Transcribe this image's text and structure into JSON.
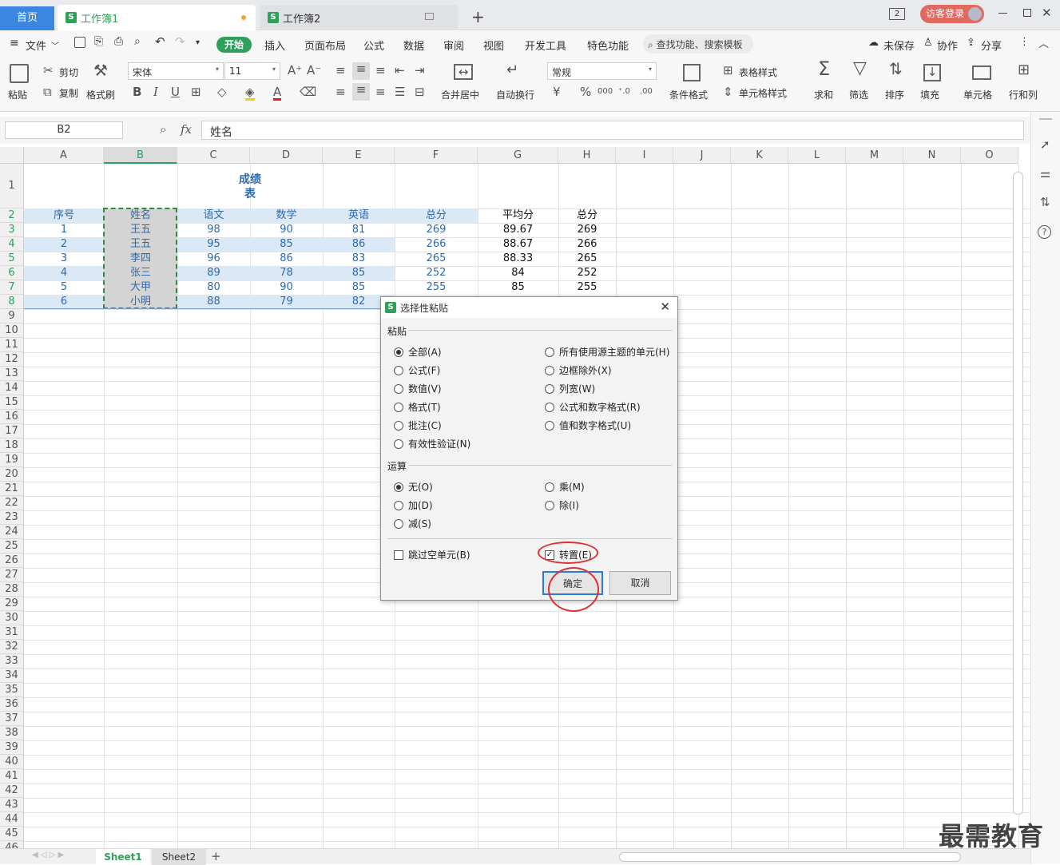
{
  "tabs": {
    "home": "首页",
    "book1": "工作簿1",
    "book2": "工作簿2",
    "plus": "+",
    "badge": "2",
    "login": "访客登录"
  },
  "menu": {
    "file": "文件",
    "items": [
      "开始",
      "插入",
      "页面布局",
      "公式",
      "数据",
      "审阅",
      "视图",
      "开发工具",
      "特色功能"
    ],
    "search": "查找功能、搜索模板",
    "unsaved": "未保存",
    "collab": "协作",
    "share": "分享"
  },
  "ribbon": {
    "paste": "粘贴",
    "cut": "剪切",
    "copy": "复制",
    "format_painter": "格式刷",
    "font": "宋体",
    "size": "11",
    "bold": "B",
    "italic": "I",
    "underline": "U",
    "merge": "合并居中",
    "wrap": "自动换行",
    "number_format": "常规",
    "cond_format": "条件格式",
    "table_style": "表格样式",
    "cell_style": "单元格样式",
    "sum": "求和",
    "filter": "筛选",
    "sort": "排序",
    "fill": "填充",
    "cell": "单元格",
    "rowcol": "行和列"
  },
  "formula": {
    "namebox": "B2",
    "fx": "fx",
    "value": "姓名"
  },
  "columns": [
    "A",
    "B",
    "C",
    "D",
    "E",
    "F",
    "G",
    "H",
    "I",
    "J",
    "K",
    "L",
    "M",
    "N",
    "O"
  ],
  "rows": [
    "1",
    "2",
    "3",
    "4",
    "5",
    "6",
    "7",
    "8",
    "9",
    "10",
    "11",
    "12",
    "13",
    "14",
    "15",
    "16",
    "17",
    "18",
    "19",
    "20",
    "21",
    "22",
    "23",
    "24",
    "25",
    "26",
    "27",
    "28",
    "29",
    "30",
    "31",
    "32",
    "33",
    "34",
    "35",
    "36",
    "37",
    "38",
    "39",
    "40",
    "41",
    "42",
    "43",
    "44",
    "45",
    "46"
  ],
  "table": {
    "title1": "成绩",
    "title2": "表",
    "headers": [
      "序号",
      "姓名",
      "语文",
      "数学",
      "英语",
      "总分"
    ],
    "extra_headers": [
      "平均分",
      "总分"
    ],
    "data": [
      [
        "1",
        "王五",
        "98",
        "90",
        "81",
        "269"
      ],
      [
        "2",
        "王五",
        "95",
        "85",
        "86",
        "266"
      ],
      [
        "3",
        "李四",
        "96",
        "86",
        "83",
        "265"
      ],
      [
        "4",
        "张三",
        "89",
        "78",
        "85",
        "252"
      ],
      [
        "5",
        "大甲",
        "80",
        "90",
        "85",
        "255"
      ],
      [
        "6",
        "小明",
        "88",
        "79",
        "82",
        ""
      ]
    ],
    "extra": [
      [
        "89.67",
        "269"
      ],
      [
        "88.67",
        "266"
      ],
      [
        "88.33",
        "265"
      ],
      [
        "84",
        "252"
      ],
      [
        "85",
        "255"
      ]
    ]
  },
  "sheets": {
    "sheet1": "Sheet1",
    "sheet2": "Sheet2"
  },
  "dialog": {
    "title": "选择性粘贴",
    "paste_section": "粘贴",
    "paste_left": [
      "全部(A)",
      "公式(F)",
      "数值(V)",
      "格式(T)",
      "批注(C)",
      "有效性验证(N)"
    ],
    "paste_right": [
      "所有使用源主题的单元(H)",
      "边框除外(X)",
      "列宽(W)",
      "公式和数字格式(R)",
      "值和数字格式(U)"
    ],
    "op_section": "运算",
    "op_left": [
      "无(O)",
      "加(D)",
      "减(S)"
    ],
    "op_right": [
      "乘(M)",
      "除(I)"
    ],
    "skip_blanks": "跳过空单元(B)",
    "transpose": "转置(E)",
    "ok": "确定",
    "cancel": "取消"
  },
  "watermark": "最需教育"
}
